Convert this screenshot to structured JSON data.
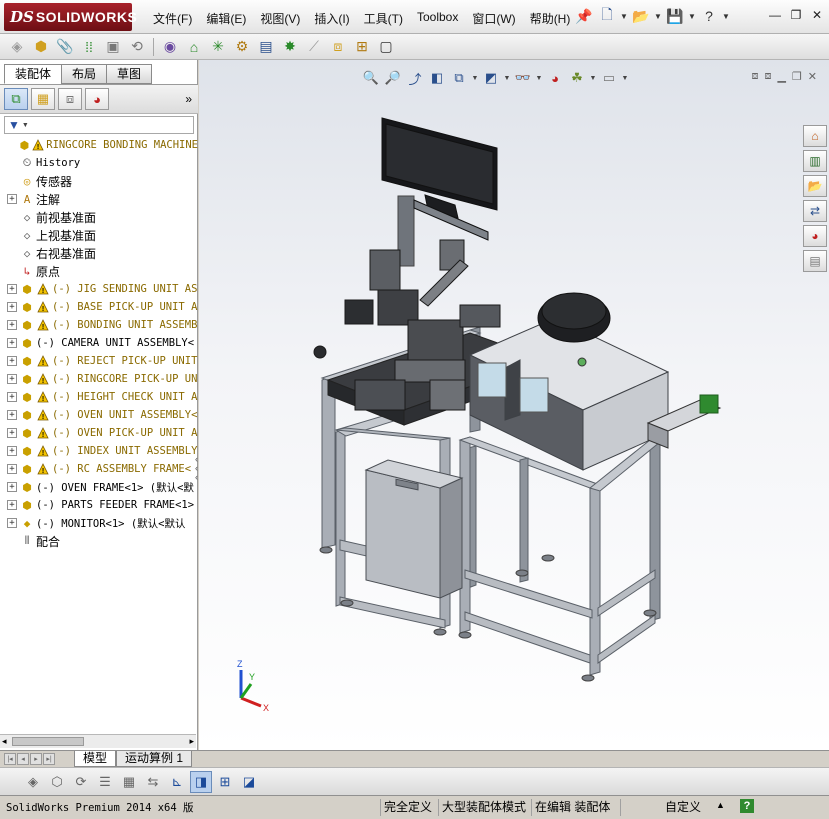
{
  "app": {
    "logo_ds": "DS",
    "logo_name": "SOLIDWORKS"
  },
  "menu": [
    "文件(F)",
    "编辑(E)",
    "视图(V)",
    "插入(I)",
    "工具(T)",
    "Toolbox",
    "窗口(W)",
    "帮助(H)"
  ],
  "command_manager": {
    "tabs": [
      "装配体",
      "布局",
      "草图"
    ],
    "active_tab": "装配体"
  },
  "feature_tree": {
    "root": "RINGCORE BONDING MACHINE",
    "items": [
      {
        "label": "History",
        "icon": "history-icon",
        "expand": false,
        "warn": false,
        "cjk": false
      },
      {
        "label": "传感器",
        "icon": "sensor-icon",
        "expand": false,
        "warn": false,
        "cjk": true
      },
      {
        "label": "注解",
        "icon": "annotation-icon",
        "expand": true,
        "warn": false,
        "cjk": true
      },
      {
        "label": "前视基准面",
        "icon": "plane-icon",
        "expand": false,
        "warn": false,
        "cjk": true
      },
      {
        "label": "上视基准面",
        "icon": "plane-icon",
        "expand": false,
        "warn": false,
        "cjk": true
      },
      {
        "label": "右视基准面",
        "icon": "plane-icon",
        "expand": false,
        "warn": false,
        "cjk": true
      },
      {
        "label": "原点",
        "icon": "origin-icon",
        "expand": false,
        "warn": false,
        "cjk": true
      },
      {
        "label": "(-) JIG SENDING UNIT AS",
        "icon": "assembly-icon",
        "expand": true,
        "warn": true,
        "cjk": false
      },
      {
        "label": "(-) BASE PICK-UP UNIT A",
        "icon": "assembly-icon",
        "expand": true,
        "warn": true,
        "cjk": false
      },
      {
        "label": "(-) BONDING UNIT ASSEMB",
        "icon": "assembly-icon",
        "expand": true,
        "warn": true,
        "cjk": false
      },
      {
        "label": "(-) CAMERA UNIT ASSEMBLY<",
        "icon": "assembly-icon",
        "expand": true,
        "warn": false,
        "cjk": false
      },
      {
        "label": "(-) REJECT PICK-UP UNIT",
        "icon": "assembly-icon",
        "expand": true,
        "warn": true,
        "cjk": false
      },
      {
        "label": "(-) RINGCORE PICK-UP UN",
        "icon": "assembly-icon",
        "expand": true,
        "warn": true,
        "cjk": false
      },
      {
        "label": "(-) HEIGHT CHECK UNIT A",
        "icon": "assembly-icon",
        "expand": true,
        "warn": true,
        "cjk": false
      },
      {
        "label": "(-) OVEN UNIT ASSEMBLY<",
        "icon": "assembly-icon",
        "expand": true,
        "warn": true,
        "cjk": false
      },
      {
        "label": "(-) OVEN PICK-UP UNIT A",
        "icon": "assembly-icon",
        "expand": true,
        "warn": true,
        "cjk": false
      },
      {
        "label": "(-) INDEX UNIT ASSEMBLY",
        "icon": "assembly-icon",
        "expand": true,
        "warn": true,
        "cjk": false
      },
      {
        "label": "(-) RC ASSEMBLY  FRAME<",
        "icon": "assembly-icon",
        "expand": true,
        "warn": true,
        "cjk": false
      },
      {
        "label": "(-) OVEN FRAME<1> (默认<默",
        "icon": "assembly-icon",
        "expand": true,
        "warn": false,
        "cjk": false
      },
      {
        "label": "(-) PARTS FEEDER FRAME<1>",
        "icon": "assembly-icon",
        "expand": true,
        "warn": false,
        "cjk": false
      },
      {
        "label": "(-) MONITOR<1> (默认<默认",
        "icon": "part-icon",
        "expand": true,
        "warn": false,
        "cjk": false
      },
      {
        "label": "配合",
        "icon": "mates-icon",
        "expand": false,
        "warn": false,
        "cjk": true
      }
    ]
  },
  "bottom_tabs": [
    "模型",
    "运动算例 1"
  ],
  "status": {
    "product": "SolidWorks Premium 2014 x64 版",
    "cells": [
      "完全定义",
      "大型装配体模式",
      "在编辑 装配体",
      "自定义"
    ],
    "help": "?"
  },
  "triad": {
    "z": "Z",
    "y": "Y",
    "x": "X"
  },
  "colors": {
    "accent": "#1b4a9a",
    "logo_red": "#a8222b",
    "warning": "#f4c400",
    "frame_gray": "#9aa0a8",
    "machine_dark": "#2d2f33"
  }
}
